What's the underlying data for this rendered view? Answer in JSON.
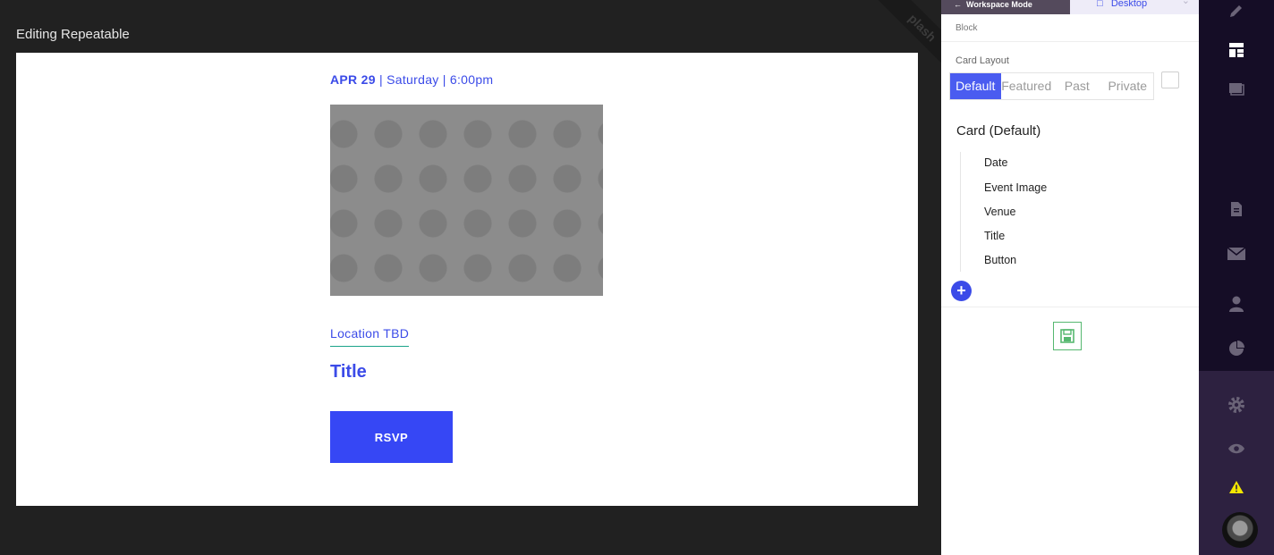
{
  "canvas": {
    "title": "Editing Repeatable",
    "ribbon_text": "plash"
  },
  "card": {
    "date_strong": "APR 29",
    "date_rest": " | Saturday | 6:00pm",
    "location": "Location TBD",
    "title": "Title",
    "button_label": "RSVP"
  },
  "panel": {
    "workspace_tab": "Workspace Mode",
    "device_tab": "Desktop",
    "block_label": "Block",
    "layout_label": "Card Layout",
    "layout_options": [
      "Default",
      "Featured",
      "Past",
      "Private"
    ],
    "selected_layout": "Default",
    "card_heading": "Card (Default)",
    "elements": [
      "Date",
      "Event Image",
      "Venue",
      "Title",
      "Button"
    ],
    "add_label": "+"
  },
  "rail": {
    "icons": [
      "pencil-icon",
      "layout-icon",
      "gallery-icon",
      "document-icon",
      "mail-icon",
      "user-icon",
      "pie-chart-icon",
      "gear-icon",
      "eye-icon",
      "warning-icon"
    ]
  },
  "colors": {
    "accent": "#3b4be8",
    "rail_dark": "#150d26",
    "rail_light": "#2d2140",
    "save_green": "#56b870",
    "warning": "#f2e600"
  }
}
